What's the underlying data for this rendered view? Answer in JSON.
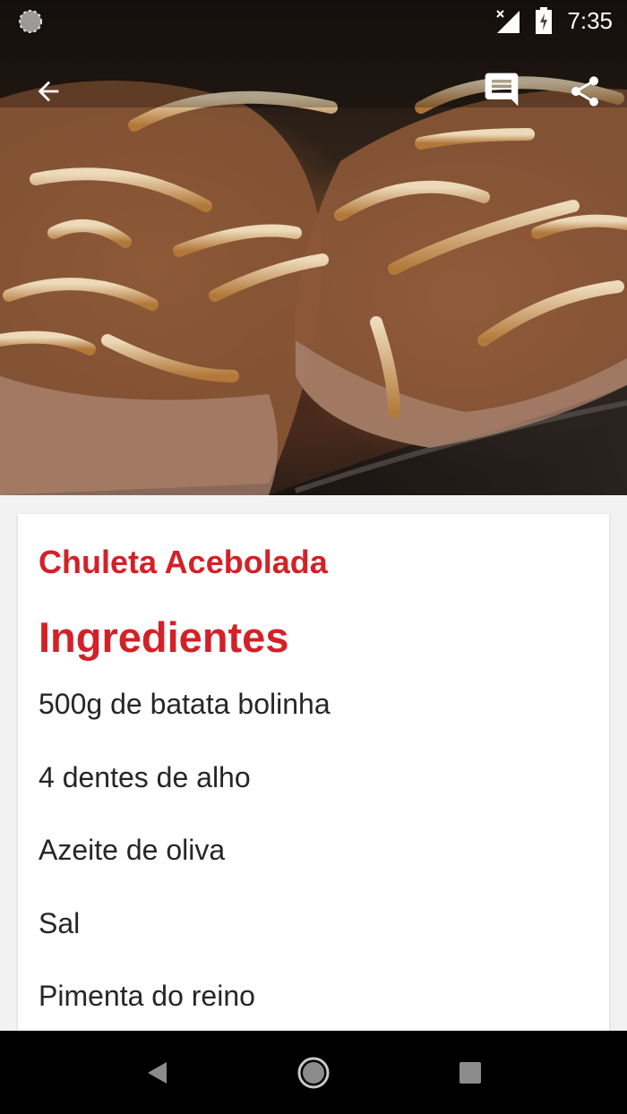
{
  "status_bar": {
    "time": "7:35"
  },
  "toolbar": {
    "back_icon": "arrow-back-icon",
    "comments_icon": "comment-icon",
    "share_icon": "share-icon"
  },
  "recipe": {
    "title": "Chuleta Acebolada",
    "ingredients_heading": "Ingredientes",
    "ingredients": [
      "500g de batata bolinha",
      "4 dentes de alho",
      "Azeite de oliva",
      "Sal",
      "Pimenta do reino"
    ]
  },
  "colors": {
    "accent": "#d32128",
    "text": "#262626",
    "nav_background": "#000000"
  }
}
